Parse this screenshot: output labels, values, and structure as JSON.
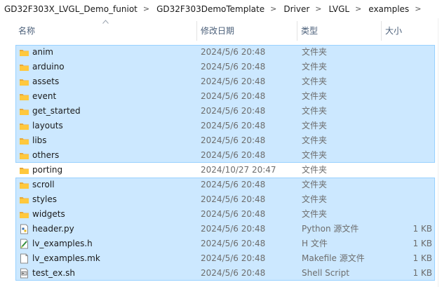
{
  "breadcrumb": {
    "items": [
      "GD32F303X_LVGL_Demo_funiot",
      "GD32F303DemoTemplate",
      "Driver",
      "LVGL",
      "examples"
    ],
    "separator": ">"
  },
  "columns": {
    "name": "名称",
    "date": "修改日期",
    "type": "类型",
    "size": "大小"
  },
  "colors": {
    "selection_fill": "#cce8ff",
    "selection_border": "#99d1ff",
    "folder": "#ffc83d",
    "header_text": "#4c607a"
  },
  "files": [
    {
      "name": "anim",
      "date": "2024/5/6 20:48",
      "type": "文件夹",
      "size": "",
      "icon": "folder-icon",
      "selected": true
    },
    {
      "name": "arduino",
      "date": "2024/5/6 20:48",
      "type": "文件夹",
      "size": "",
      "icon": "folder-icon",
      "selected": true
    },
    {
      "name": "assets",
      "date": "2024/5/6 20:48",
      "type": "文件夹",
      "size": "",
      "icon": "folder-icon",
      "selected": true
    },
    {
      "name": "event",
      "date": "2024/5/6 20:48",
      "type": "文件夹",
      "size": "",
      "icon": "folder-icon",
      "selected": true
    },
    {
      "name": "get_started",
      "date": "2024/5/6 20:48",
      "type": "文件夹",
      "size": "",
      "icon": "folder-icon",
      "selected": true
    },
    {
      "name": "layouts",
      "date": "2024/5/6 20:48",
      "type": "文件夹",
      "size": "",
      "icon": "folder-icon",
      "selected": true
    },
    {
      "name": "libs",
      "date": "2024/5/6 20:48",
      "type": "文件夹",
      "size": "",
      "icon": "folder-icon",
      "selected": true
    },
    {
      "name": "others",
      "date": "2024/5/6 20:48",
      "type": "文件夹",
      "size": "",
      "icon": "folder-icon",
      "selected": true
    },
    {
      "name": "porting",
      "date": "2024/10/27 20:47",
      "type": "文件夹",
      "size": "",
      "icon": "folder-icon",
      "selected": false
    },
    {
      "name": "scroll",
      "date": "2024/5/6 20:48",
      "type": "文件夹",
      "size": "",
      "icon": "folder-icon",
      "selected": true
    },
    {
      "name": "styles",
      "date": "2024/5/6 20:48",
      "type": "文件夹",
      "size": "",
      "icon": "folder-icon",
      "selected": true
    },
    {
      "name": "widgets",
      "date": "2024/5/6 20:48",
      "type": "文件夹",
      "size": "",
      "icon": "folder-icon",
      "selected": true
    },
    {
      "name": "header.py",
      "date": "2024/5/6 20:48",
      "type": "Python 源文件",
      "size": "1 KB",
      "icon": "python-file-icon",
      "selected": true
    },
    {
      "name": "lv_examples.h",
      "date": "2024/5/6 20:48",
      "type": "H 文件",
      "size": "1 KB",
      "icon": "header-file-icon",
      "selected": true
    },
    {
      "name": "lv_examples.mk",
      "date": "2024/5/6 20:48",
      "type": "Makefile 源文件",
      "size": "1 KB",
      "icon": "makefile-icon",
      "selected": true
    },
    {
      "name": "test_ex.sh",
      "date": "2024/5/6 20:48",
      "type": "Shell Script",
      "size": "1 KB",
      "icon": "shell-script-icon",
      "selected": true
    }
  ]
}
